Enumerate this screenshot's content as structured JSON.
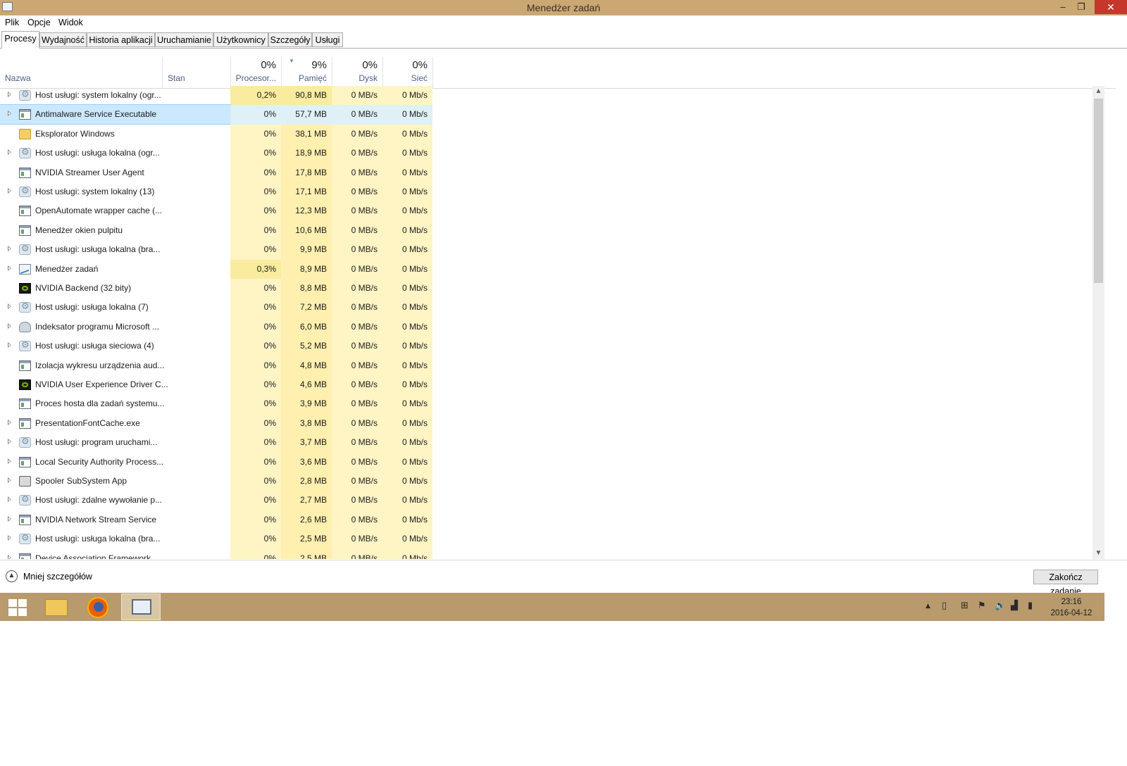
{
  "window": {
    "title": "Menedżer zadań",
    "minimize_glyph": "–",
    "maximize_glyph": "❐",
    "close_glyph": "✕"
  },
  "menu": [
    "Plik",
    "Opcje",
    "Widok"
  ],
  "tabs": [
    "Procesy",
    "Wydajność",
    "Historia aplikacji",
    "Uruchamianie",
    "Użytkownicy",
    "Szczegóły",
    "Usługi"
  ],
  "header": {
    "name_label": "Nazwa",
    "status_label": "Stan",
    "cpu": {
      "pct": "0%",
      "label": "Procesor..."
    },
    "mem": {
      "pct": "9%",
      "label": "Pamięć"
    },
    "disk": {
      "pct": "0%",
      "label": "Dysk"
    },
    "net": {
      "pct": "0%",
      "label": "Sieć"
    }
  },
  "processes": [
    {
      "name": "Host usługi: system lokalny (ogr...",
      "icon": "gear-icon",
      "expandable": true,
      "cpu": "0,2%",
      "mem": "90,8 MB",
      "disk": "0 MB/s",
      "net": "0 Mb/s"
    },
    {
      "name": "Antimalware Service Executable",
      "icon": "app-icon",
      "expandable": true,
      "cpu": "0%",
      "mem": "57,7 MB",
      "disk": "0 MB/s",
      "net": "0 Mb/s",
      "selected": true
    },
    {
      "name": "Eksplorator Windows",
      "icon": "folder-icon",
      "expandable": false,
      "cpu": "0%",
      "mem": "38,1 MB",
      "disk": "0 MB/s",
      "net": "0 Mb/s"
    },
    {
      "name": "Host usługi: usługa lokalna (ogr...",
      "icon": "gear-icon",
      "expandable": true,
      "cpu": "0%",
      "mem": "18,9 MB",
      "disk": "0 MB/s",
      "net": "0 Mb/s"
    },
    {
      "name": "NVIDIA Streamer User Agent",
      "icon": "app-icon",
      "expandable": false,
      "cpu": "0%",
      "mem": "17,8 MB",
      "disk": "0 MB/s",
      "net": "0 Mb/s"
    },
    {
      "name": "Host usługi: system lokalny (13)",
      "icon": "gear-icon",
      "expandable": true,
      "cpu": "0%",
      "mem": "17,1 MB",
      "disk": "0 MB/s",
      "net": "0 Mb/s"
    },
    {
      "name": "OpenAutomate wrapper cache (...",
      "icon": "app-icon",
      "expandable": false,
      "cpu": "0%",
      "mem": "12,3 MB",
      "disk": "0 MB/s",
      "net": "0 Mb/s"
    },
    {
      "name": "Menedżer okien pulpitu",
      "icon": "app-icon",
      "expandable": false,
      "cpu": "0%",
      "mem": "10,6 MB",
      "disk": "0 MB/s",
      "net": "0 Mb/s"
    },
    {
      "name": "Host usługi: usługa lokalna (bra...",
      "icon": "gear-icon",
      "expandable": true,
      "cpu": "0%",
      "mem": "9,9 MB",
      "disk": "0 MB/s",
      "net": "0 Mb/s"
    },
    {
      "name": "Menedżer zadań",
      "icon": "chart-icon",
      "expandable": true,
      "cpu": "0,3%",
      "mem": "8,9 MB",
      "disk": "0 MB/s",
      "net": "0 Mb/s"
    },
    {
      "name": "NVIDIA Backend (32 bity)",
      "icon": "nvidia-icon",
      "expandable": false,
      "cpu": "0%",
      "mem": "8,8 MB",
      "disk": "0 MB/s",
      "net": "0 Mb/s"
    },
    {
      "name": "Host usługi: usługa lokalna (7)",
      "icon": "gear-icon",
      "expandable": true,
      "cpu": "0%",
      "mem": "7,2 MB",
      "disk": "0 MB/s",
      "net": "0 Mb/s"
    },
    {
      "name": "Indeksator programu Microsoft ...",
      "icon": "user-icon",
      "expandable": true,
      "cpu": "0%",
      "mem": "6,0 MB",
      "disk": "0 MB/s",
      "net": "0 Mb/s"
    },
    {
      "name": "Host usługi: usługa sieciowa (4)",
      "icon": "gear-icon",
      "expandable": true,
      "cpu": "0%",
      "mem": "5,2 MB",
      "disk": "0 MB/s",
      "net": "0 Mb/s"
    },
    {
      "name": "Izolacja wykresu urządzenia aud...",
      "icon": "app-icon",
      "expandable": false,
      "cpu": "0%",
      "mem": "4,8 MB",
      "disk": "0 MB/s",
      "net": "0 Mb/s"
    },
    {
      "name": "NVIDIA User Experience Driver C...",
      "icon": "nvidia-icon",
      "expandable": false,
      "cpu": "0%",
      "mem": "4,6 MB",
      "disk": "0 MB/s",
      "net": "0 Mb/s"
    },
    {
      "name": "Proces hosta dla zadań systemu...",
      "icon": "app-icon",
      "expandable": false,
      "cpu": "0%",
      "mem": "3,9 MB",
      "disk": "0 MB/s",
      "net": "0 Mb/s"
    },
    {
      "name": "PresentationFontCache.exe",
      "icon": "app-icon",
      "expandable": true,
      "cpu": "0%",
      "mem": "3,8 MB",
      "disk": "0 MB/s",
      "net": "0 Mb/s"
    },
    {
      "name": "Host usługi: program uruchami...",
      "icon": "gear-icon",
      "expandable": true,
      "cpu": "0%",
      "mem": "3,7 MB",
      "disk": "0 MB/s",
      "net": "0 Mb/s"
    },
    {
      "name": "Local Security Authority Process...",
      "icon": "app-icon",
      "expandable": true,
      "cpu": "0%",
      "mem": "3,6 MB",
      "disk": "0 MB/s",
      "net": "0 Mb/s"
    },
    {
      "name": "Spooler SubSystem App",
      "icon": "printer-icon",
      "expandable": true,
      "cpu": "0%",
      "mem": "2,8 MB",
      "disk": "0 MB/s",
      "net": "0 Mb/s"
    },
    {
      "name": "Host usługi: zdalne wywołanie p...",
      "icon": "gear-icon",
      "expandable": true,
      "cpu": "0%",
      "mem": "2,7 MB",
      "disk": "0 MB/s",
      "net": "0 Mb/s"
    },
    {
      "name": "NVIDIA Network Stream Service",
      "icon": "app-icon",
      "expandable": true,
      "cpu": "0%",
      "mem": "2,6 MB",
      "disk": "0 MB/s",
      "net": "0 Mb/s"
    },
    {
      "name": "Host usługi: usługa lokalna (bra...",
      "icon": "gear-icon",
      "expandable": true,
      "cpu": "0%",
      "mem": "2,5 MB",
      "disk": "0 MB/s",
      "net": "0 Mb/s"
    },
    {
      "name": "Device Association Framework ...",
      "icon": "app-icon",
      "expandable": true,
      "cpu": "0%",
      "mem": "2,5 MB",
      "disk": "0 MB/s",
      "net": "0 Mb/s"
    }
  ],
  "footer": {
    "less_details": "Mniej szczegółów",
    "end_task": "Zakończ zadanie"
  },
  "taskbar": {
    "time": "23:16",
    "date": "2016-04-12",
    "tray_icons": [
      "show-hidden-icons-icon",
      "battery-icon",
      "action-center-icon",
      "flag-icon",
      "volume-icon",
      "network-icon",
      "power-icon"
    ]
  },
  "colors": {
    "titlebar": "#cba774",
    "taskbar": "#b89a6c",
    "close": "#c7362b",
    "heat": "#fff4c4",
    "selected": "#cce8ff"
  }
}
